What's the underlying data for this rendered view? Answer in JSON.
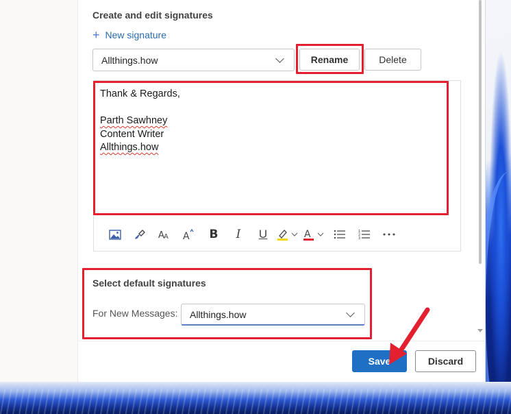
{
  "signatures_section": {
    "title": "Create and edit signatures",
    "new_signature_label": "New signature",
    "selected_signature": "Allthings.how",
    "rename_label": "Rename",
    "delete_label": "Delete"
  },
  "editor": {
    "lines": [
      "Thank & Regards,",
      "",
      "Parth Sawhney",
      "Content Writer",
      "Allthings.how"
    ]
  },
  "toolbar_icons": [
    "insert-image-icon",
    "format-painter-icon",
    "font-size-icon",
    "grow-font-icon",
    "bold-icon",
    "italic-icon",
    "underline-icon",
    "highlight-color-icon",
    "font-color-icon",
    "bullets-icon",
    "numbering-icon",
    "more-options-icon"
  ],
  "default_section": {
    "title": "Select default signatures",
    "for_new_messages_label": "For New Messages:",
    "for_new_messages_value": "Allthings.how"
  },
  "footer": {
    "save_label": "Save",
    "discard_label": "Discard"
  },
  "colors": {
    "accent": "#1f6fc4",
    "annotation_red": "#e3202f",
    "highlight_yellow": "#f2d600",
    "font_color_red": "#e3202f"
  }
}
